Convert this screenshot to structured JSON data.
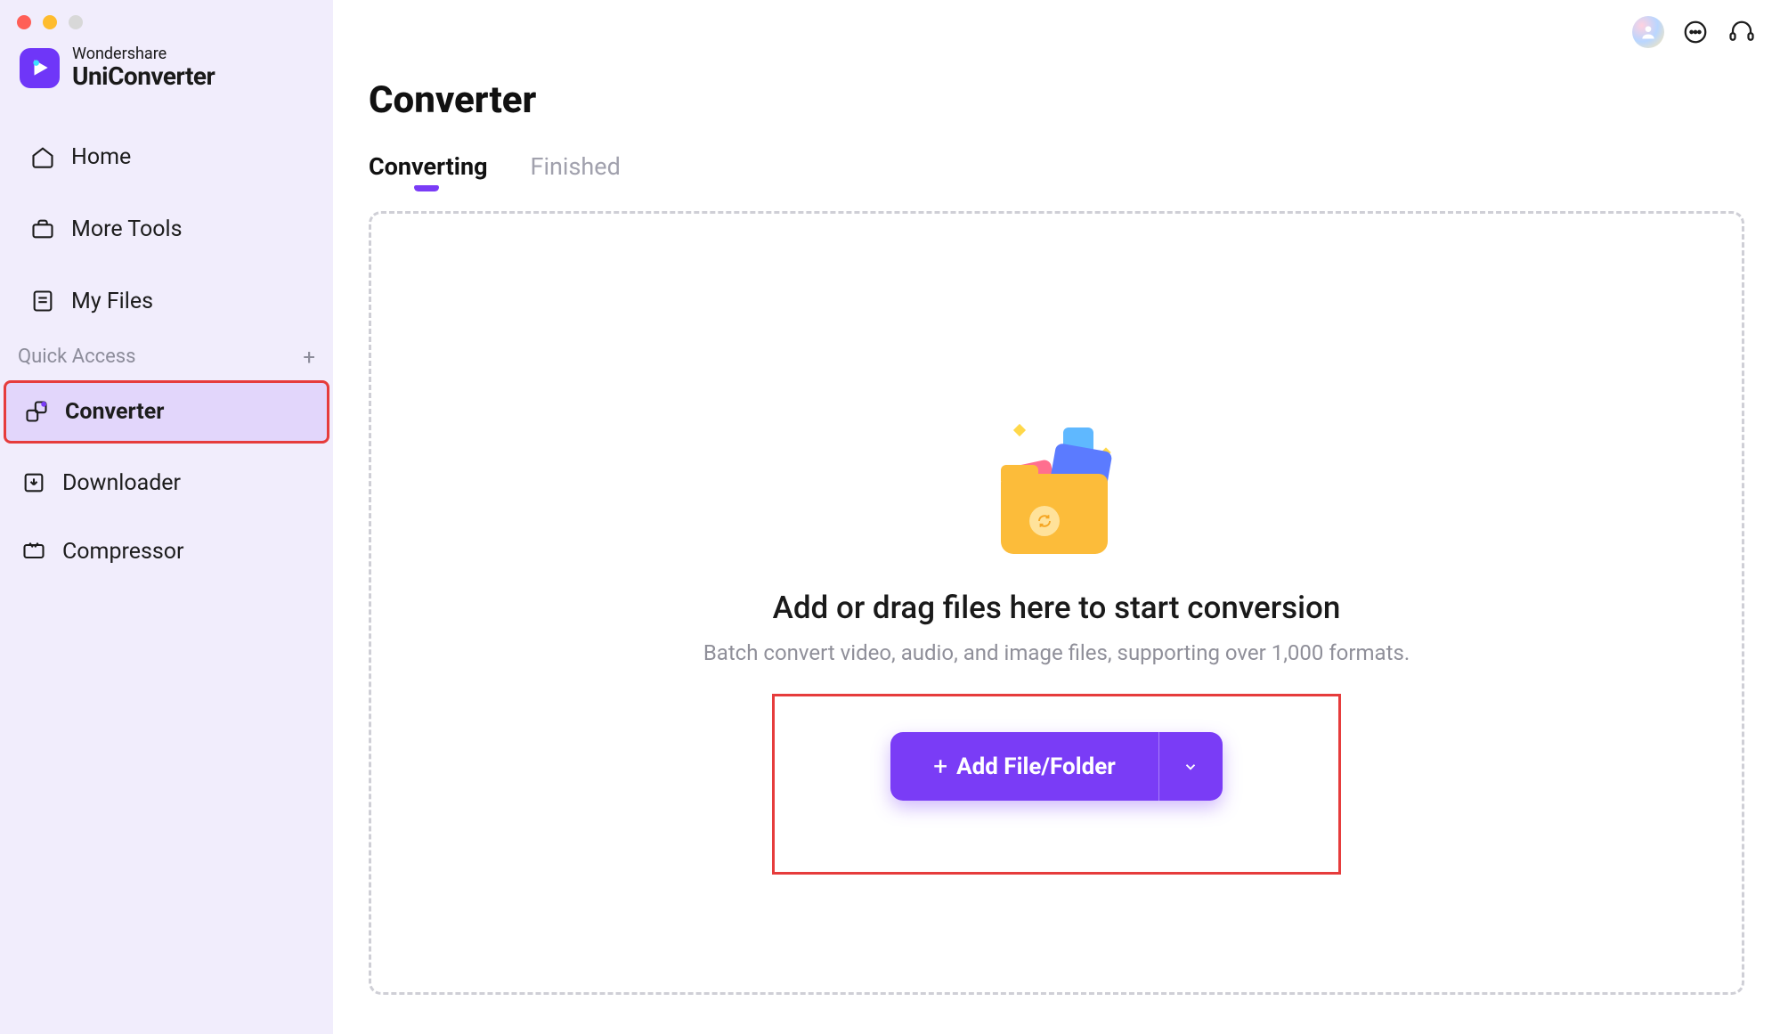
{
  "brand": {
    "top": "Wondershare",
    "bottom": "UniConverter"
  },
  "nav": {
    "home": "Home",
    "more_tools": "More Tools",
    "my_files": "My Files"
  },
  "quick_access": {
    "label": "Quick Access",
    "items": {
      "converter": "Converter",
      "downloader": "Downloader",
      "compressor": "Compressor"
    }
  },
  "main": {
    "title": "Converter",
    "tabs": {
      "converting": "Converting",
      "finished": "Finished"
    },
    "drop_title": "Add or drag files here to start conversion",
    "drop_sub": "Batch convert video, audio, and image files, supporting over 1,000 formats.",
    "cta_label": "Add File/Folder"
  }
}
